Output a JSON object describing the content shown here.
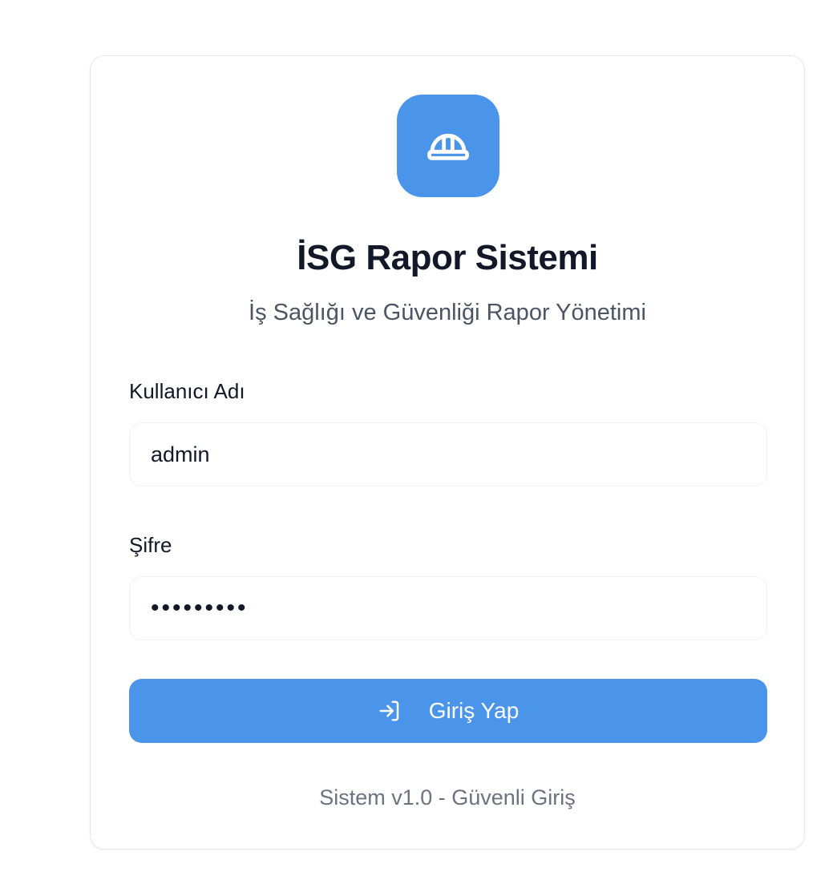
{
  "app": {
    "title": "İSG Rapor Sistemi",
    "subtitle": "İş Sağlığı ve Güvenliği Rapor Yönetimi",
    "logo_icon": "hard-hat-icon",
    "accent_color": "#4a94ea"
  },
  "form": {
    "username_label": "Kullanıcı Adı",
    "username_value": "admin",
    "password_label": "Şifre",
    "password_value": "•••••••••",
    "submit_label": "Giriş Yap",
    "submit_icon": "login-arrow-icon"
  },
  "footer": {
    "text": "Sistem v1.0 - Güvenli Giriş"
  }
}
